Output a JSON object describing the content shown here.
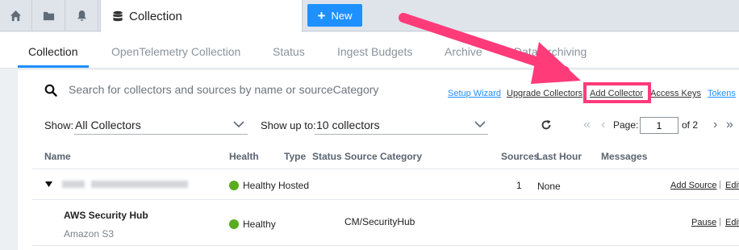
{
  "topbar": {
    "icons": [
      "home-icon",
      "folder-icon",
      "bell-icon"
    ],
    "active_tab": {
      "icon": "database-icon",
      "label": "Collection"
    },
    "new_button": "New"
  },
  "subnav": {
    "tabs": [
      "Collection",
      "OpenTelemetry Collection",
      "Status",
      "Ingest Budgets",
      "Archive",
      "Data Archiving"
    ],
    "active": "Collection"
  },
  "search": {
    "placeholder": "Search for collectors and sources by name or sourceCategory"
  },
  "actions": {
    "setup_wizard": "Setup Wizard",
    "upgrade_collectors": "Upgrade Collectors",
    "add_collector": "Add Collector",
    "access_keys": "Access Keys",
    "tokens": "Tokens"
  },
  "filters": {
    "show_label": "Show:",
    "show_value": "All Collectors",
    "show_up_to_label": "Show up to:",
    "show_up_to_value": "10 collectors"
  },
  "pagination": {
    "page_label": "Page:",
    "page_value": "1",
    "of_label": "of 2"
  },
  "table": {
    "headers": {
      "name": "Name",
      "health": "Health",
      "type": "Type",
      "status": "Status",
      "source_category": "Source Category",
      "sources": "Sources",
      "last_hour": "Last Hour",
      "messages": "Messages"
    },
    "rows": [
      {
        "name": "",
        "health": "Healthy",
        "type": "Hosted",
        "sources": "1",
        "last_hour": "None",
        "action": "Add Source",
        "action2": "Edit"
      },
      {
        "name": "AWS Security Hub",
        "subname": "Amazon S3",
        "health": "Healthy",
        "source_category": "CM/SecurityHub",
        "action": "Pause",
        "action2": "Edit"
      }
    ]
  },
  "colors": {
    "accent": "#1e90ff",
    "healthy": "#5aac1f",
    "highlight": "#ff3b7a"
  }
}
